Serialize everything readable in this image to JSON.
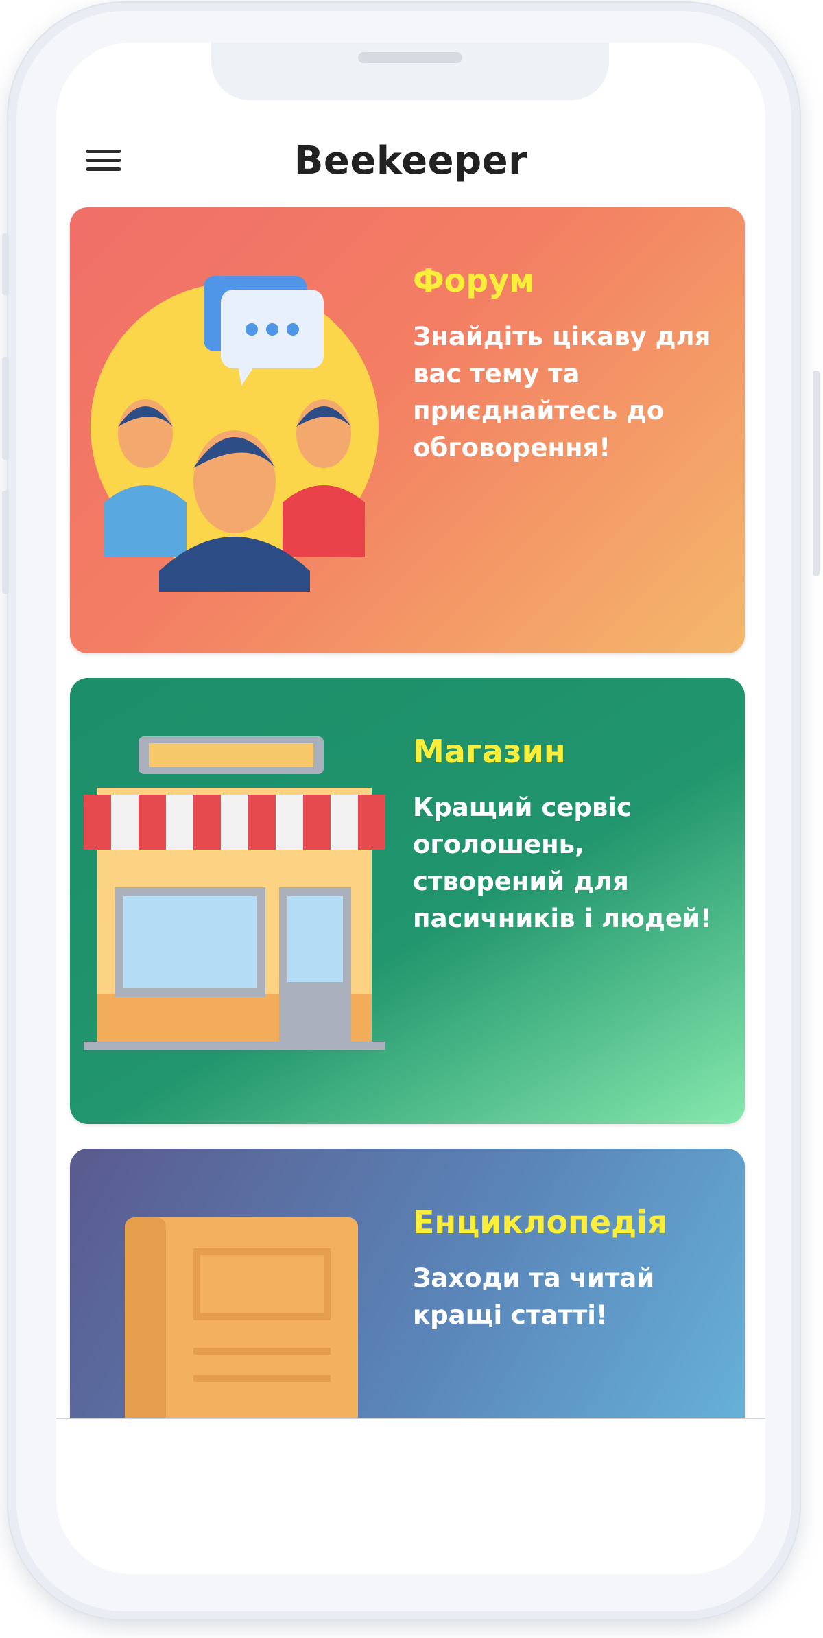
{
  "app": {
    "title": "Beekeeper"
  },
  "icons": {
    "menu": "hamburger-menu-icon"
  },
  "cards": [
    {
      "id": "forum",
      "title": "Форум",
      "description": "Знайдіть цікаву для вас тему та приєднайтесь до обговорення!",
      "illustration": "forum-people-chat-icon",
      "gradient": [
        "#f06e68",
        "#f4b86b"
      ]
    },
    {
      "id": "shop",
      "title": "Магазин",
      "description": "Кращий сервіс оголошень, створений для пасичників і людей!",
      "illustration": "storefront-icon",
      "gradient": [
        "#1c8e6a",
        "#86e8ad"
      ]
    },
    {
      "id": "encyclopedia",
      "title": "Енциклопедія",
      "description": "Заходи та читай кращі статті!",
      "illustration": "book-icon",
      "gradient": [
        "#5a5a8e",
        "#67b4db"
      ]
    }
  ],
  "colors": {
    "heading": "#fbee3a",
    "body_text": "#ffffff"
  }
}
